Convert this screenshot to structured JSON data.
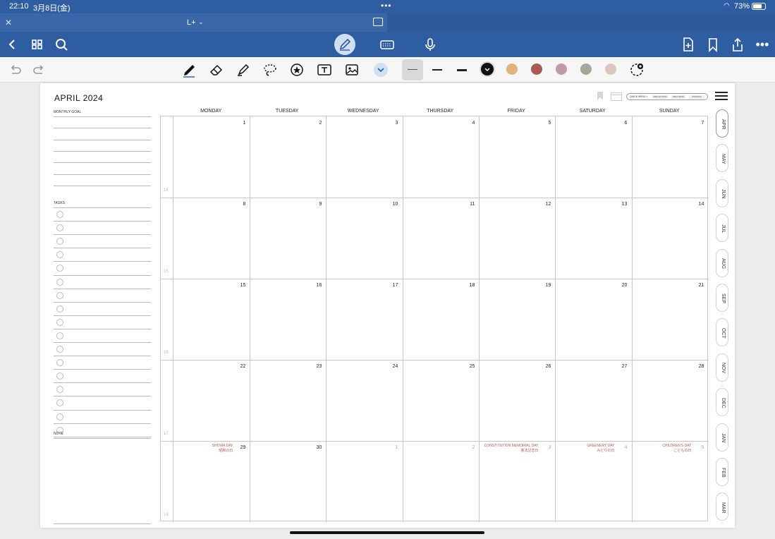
{
  "status": {
    "time": "22:10",
    "date": "3月8日(金)",
    "battery": "73%"
  },
  "tab": {
    "title": "L+"
  },
  "planner": {
    "title": "APRIL 2024",
    "monthly_goal_label": "MONTHLY GOAL",
    "tasks_label": "TASKS",
    "note_label": "NOTE",
    "quick_menu": {
      "label": "QUICK MENU >",
      "items": [
        "REFLECTION",
        "WELLNESS",
        "FINANCE"
      ]
    },
    "days": [
      "MONDAY",
      "TUESDAY",
      "WEDNESDAY",
      "THURSDAY",
      "FRIDAY",
      "SATURDAY",
      "SUNDAY"
    ],
    "weeks": [
      {
        "week": "14",
        "days": [
          "1",
          "2",
          "3",
          "4",
          "5",
          "6",
          "7"
        ]
      },
      {
        "week": "15",
        "days": [
          "8",
          "9",
          "10",
          "11",
          "12",
          "13",
          "14"
        ]
      },
      {
        "week": "16",
        "days": [
          "15",
          "16",
          "17",
          "18",
          "19",
          "20",
          "21"
        ]
      },
      {
        "week": "17",
        "days": [
          "22",
          "23",
          "24",
          "25",
          "26",
          "27",
          "28"
        ]
      },
      {
        "week": "18",
        "days": [
          "29",
          "30",
          "1",
          "2",
          "3",
          "4",
          "5"
        ]
      }
    ],
    "holidays": [
      {
        "day_index": 0,
        "en": "SHOWA DAY",
        "jp": "昭和の日"
      },
      {
        "day_index": 4,
        "en": "CONSTITUTION MEMORIAL DAY",
        "jp": "憲法記念日"
      },
      {
        "day_index": 5,
        "en": "GREENERY DAY",
        "jp": "みどりの日"
      },
      {
        "day_index": 6,
        "en": "CHILDREN'S DAY",
        "jp": "こどもの日"
      }
    ],
    "month_tabs": [
      "APR",
      "MAY",
      "JUN",
      "JUL",
      "AUG",
      "SEP",
      "OCT",
      "NOV",
      "DEC",
      "JAN",
      "FEB",
      "MAR"
    ]
  },
  "colors": {
    "accent": "#2f5da1",
    "holiday": "#b8584a",
    "swatches": [
      "#111111",
      "#e2b37c",
      "#a85a55",
      "#c09aa7",
      "#a3a89a",
      "#d8c8bf"
    ]
  }
}
